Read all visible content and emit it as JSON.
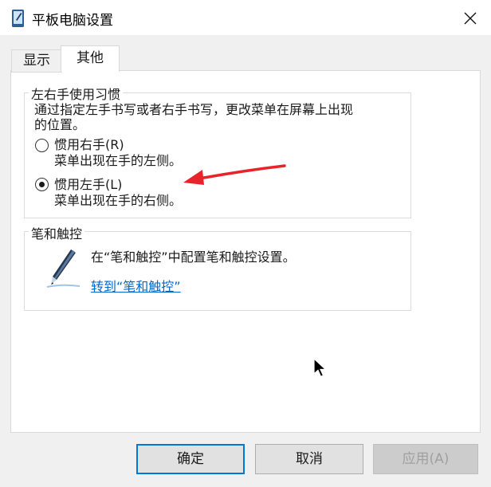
{
  "window": {
    "title": "平板电脑设置",
    "close_label": "✕"
  },
  "tabs": [
    {
      "label": "显示",
      "selected": false
    },
    {
      "label": "其他",
      "selected": true
    }
  ],
  "handedness": {
    "legend": "左右手使用习惯",
    "description_line1": "通过指定左手书写或者右手书写，更改菜单在屏幕上出现",
    "description_line2": "的位置。",
    "options": [
      {
        "label": "惯用右手(R)",
        "description": "菜单出现在手的左侧。",
        "selected": false
      },
      {
        "label": "惯用左手(L)",
        "description": "菜单出现在手的右侧。",
        "selected": true
      }
    ]
  },
  "pen_touch": {
    "legend": "笔和触控",
    "description": "在“笔和触控”中配置笔和触控设置。",
    "link": "转到“笔和触控”"
  },
  "buttons": {
    "ok": "确定",
    "cancel": "取消",
    "apply": "应用(A)",
    "apply_enabled": false
  },
  "colors": {
    "accent": "#0078d7",
    "link": "#0066cc",
    "annotation_arrow": "#e8242a"
  },
  "icons": [
    "tablet-app-icon",
    "close-icon",
    "pen-icon",
    "annotation-arrow",
    "mouse-cursor-icon"
  ]
}
